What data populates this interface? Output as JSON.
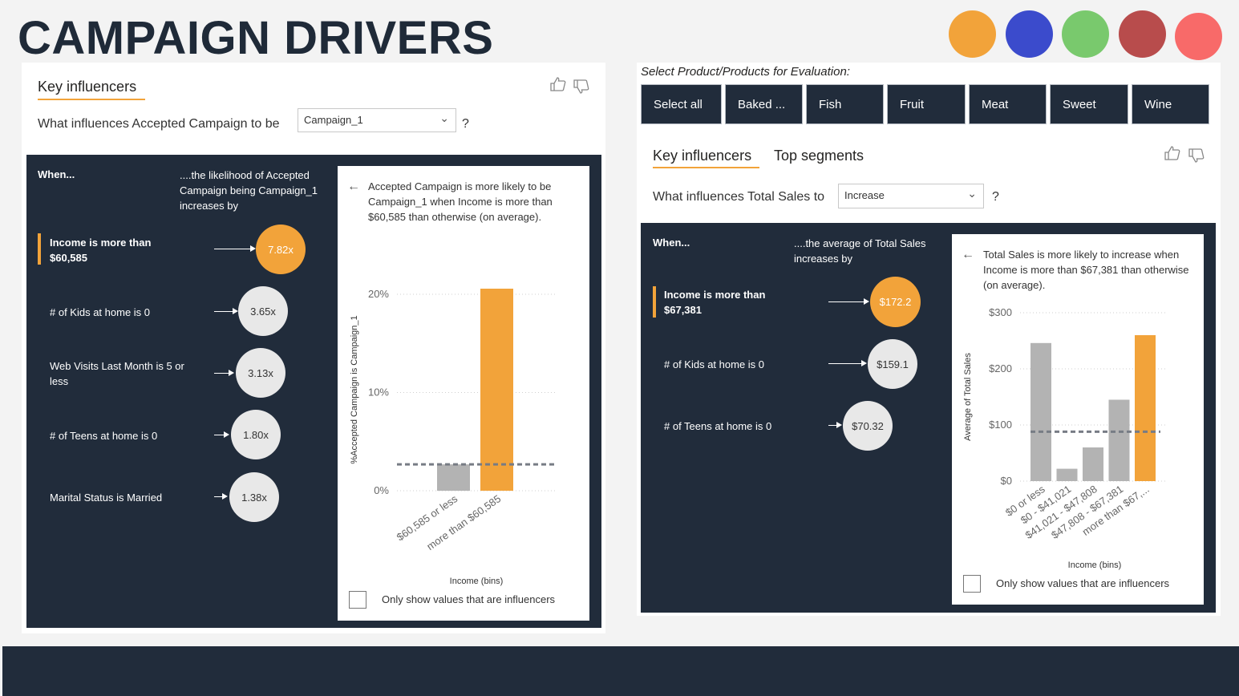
{
  "title": "CAMPAIGN DRIVERS",
  "swatches": [
    "#f2a33a",
    "#3b4bcc",
    "#79c96d",
    "#b84c4c",
    "#f86a69"
  ],
  "left": {
    "tab": "Key influencers",
    "question_prefix": "What influences Accepted Campaign to be",
    "dropdown_value": "Campaign_1",
    "question_suffix": "?",
    "when": "When...",
    "likelihood": "....the likelihood of Accepted Campaign being Campaign_1 increases by",
    "influencers": [
      {
        "label": "Income is more than $60,585",
        "value": "7.82x",
        "selected": true
      },
      {
        "label": "# of Kids at home is 0",
        "value": "3.65x",
        "selected": false
      },
      {
        "label": "Web Visits Last Month is 5 or less",
        "value": "3.13x",
        "selected": false
      },
      {
        "label": "# of Teens at home is 0",
        "value": "1.80x",
        "selected": false
      },
      {
        "label": "Marital Status is Married",
        "value": "1.38x",
        "selected": false
      }
    ],
    "detail_text": "Accepted Campaign is more likely to be Campaign_1 when Income is more than $60,585 than otherwise (on average).",
    "checkbox_label": "Only show values that are influencers"
  },
  "right": {
    "slicer_caption": "Select Product/Products for Evaluation:",
    "slicer_items": [
      "Select all",
      "Baked ...",
      "Fish",
      "Fruit",
      "Meat",
      "Sweet",
      "Wine"
    ],
    "tabs": [
      "Key influencers",
      "Top segments"
    ],
    "question_prefix": "What influences Total Sales to",
    "dropdown_value": "Increase",
    "question_suffix": "?",
    "when": "When...",
    "likelihood": "....the average of Total Sales increases by",
    "influencers": [
      {
        "label": "Income is more than $67,381",
        "value": "$172.2",
        "selected": true
      },
      {
        "label": "# of Kids at home is 0",
        "value": "$159.1",
        "selected": false
      },
      {
        "label": "# of Teens at home is 0",
        "value": "$70.32",
        "selected": false
      }
    ],
    "detail_text": "Total Sales is more likely to increase when Income is more than $67,381 than otherwise (on average).",
    "checkbox_label": "Only show values that are influencers"
  },
  "chart_data": [
    {
      "type": "bar",
      "categories": [
        "$60,585 or less",
        "more than $60,585"
      ],
      "values": [
        2.7,
        20.7
      ],
      "highlight_index": 1,
      "average_line": 2.7,
      "ylabel": "%Accepted Campaign is Campaign_1",
      "xlabel": "Income (bins)",
      "yticks": [
        "0%",
        "10%",
        "20%"
      ],
      "ylim": [
        0,
        20.7
      ],
      "colors": {
        "bar": "#b3b3b3",
        "highlight": "#f2a33a",
        "avg": "#777c85"
      }
    },
    {
      "type": "bar",
      "categories": [
        "$0 or less",
        "$0 - $41,021",
        "$41,021 - $47,808",
        "$47,808 - $67,381",
        "more than $67,..."
      ],
      "values": [
        246,
        22,
        60,
        145,
        260
      ],
      "highlight_index": 4,
      "average_line": 88,
      "ylabel": "Average of Total Sales",
      "xlabel": "Income (bins)",
      "yticks": [
        "$0",
        "$100",
        "$200",
        "$300"
      ],
      "ylim": [
        0,
        300
      ],
      "colors": {
        "bar": "#b3b3b3",
        "highlight": "#f2a33a",
        "avg": "#777c85"
      }
    }
  ]
}
